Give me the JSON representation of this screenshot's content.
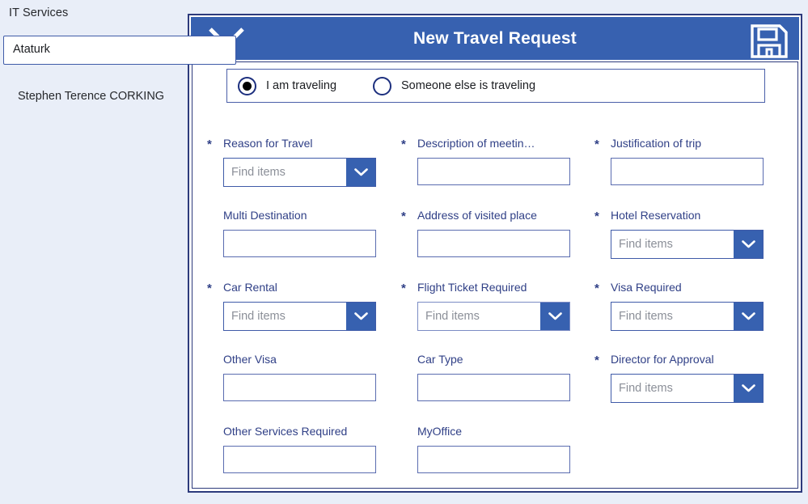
{
  "sidebar": {
    "title": "IT Services",
    "search_value": "Ataturk",
    "search_placeholder": "",
    "user_name": "Stephen Terence CORKING"
  },
  "panel": {
    "header_title": "New Travel Request",
    "close_icon": "close-icon",
    "save_icon": "save-floppy-icon",
    "header_color": "#3761b0"
  },
  "travel_mode": {
    "options": [
      {
        "label": "I am traveling",
        "checked": true
      },
      {
        "label": "Someone else is traveling",
        "checked": false
      }
    ]
  },
  "fields": [
    {
      "label": "Reason for Travel",
      "required": true,
      "type": "dropdown",
      "placeholder": "Find items",
      "value": "",
      "col": 0,
      "row": 0,
      "style": "bold"
    },
    {
      "label": "Description of meetin…",
      "required": true,
      "type": "text",
      "placeholder": "",
      "value": "",
      "col": 1,
      "row": 0,
      "style": "normal"
    },
    {
      "label": "Justification of trip",
      "required": true,
      "type": "text",
      "placeholder": "",
      "value": "",
      "col": 2,
      "row": 0,
      "style": "normal"
    },
    {
      "label": "Multi Destination",
      "required": false,
      "type": "text",
      "placeholder": "",
      "value": "",
      "col": 0,
      "row": 1,
      "style": "normal"
    },
    {
      "label": "Address of visited place",
      "required": true,
      "type": "text",
      "placeholder": "",
      "value": "",
      "col": 1,
      "row": 1,
      "style": "normal"
    },
    {
      "label": "Hotel Reservation",
      "required": true,
      "type": "dropdown",
      "placeholder": "Find items",
      "value": "",
      "col": 2,
      "row": 1,
      "style": "bold"
    },
    {
      "label": "Car Rental",
      "required": true,
      "type": "dropdown",
      "placeholder": "Find items",
      "value": "",
      "col": 0,
      "row": 2,
      "style": "bold"
    },
    {
      "label": "Flight Ticket Required",
      "required": true,
      "type": "dropdown",
      "placeholder": "Find items",
      "value": "",
      "col": 1,
      "row": 2,
      "style": "thin"
    },
    {
      "label": "Visa Required",
      "required": true,
      "type": "dropdown",
      "placeholder": "Find items",
      "value": "",
      "col": 2,
      "row": 2,
      "style": "bold"
    },
    {
      "label": "Other Visa",
      "required": false,
      "type": "text",
      "placeholder": "",
      "value": "",
      "col": 0,
      "row": 3,
      "style": "normal"
    },
    {
      "label": "Car Type",
      "required": false,
      "type": "text",
      "placeholder": "",
      "value": "",
      "col": 1,
      "row": 3,
      "style": "normal"
    },
    {
      "label": "Director for Approval",
      "required": true,
      "type": "dropdown",
      "placeholder": "Find items",
      "value": "",
      "col": 2,
      "row": 3,
      "style": "bold"
    },
    {
      "label": "Other Services Required",
      "required": false,
      "type": "text",
      "placeholder": "",
      "value": "",
      "col": 0,
      "row": 4,
      "style": "normal"
    },
    {
      "label": "MyOffice",
      "required": false,
      "type": "text",
      "placeholder": "",
      "value": "",
      "col": 1,
      "row": 4,
      "style": "normal"
    }
  ],
  "colors": {
    "accent": "#3761b0",
    "label": "#2f3f86",
    "page_bg": "#e9eef8",
    "border": "#2d3a7c"
  }
}
